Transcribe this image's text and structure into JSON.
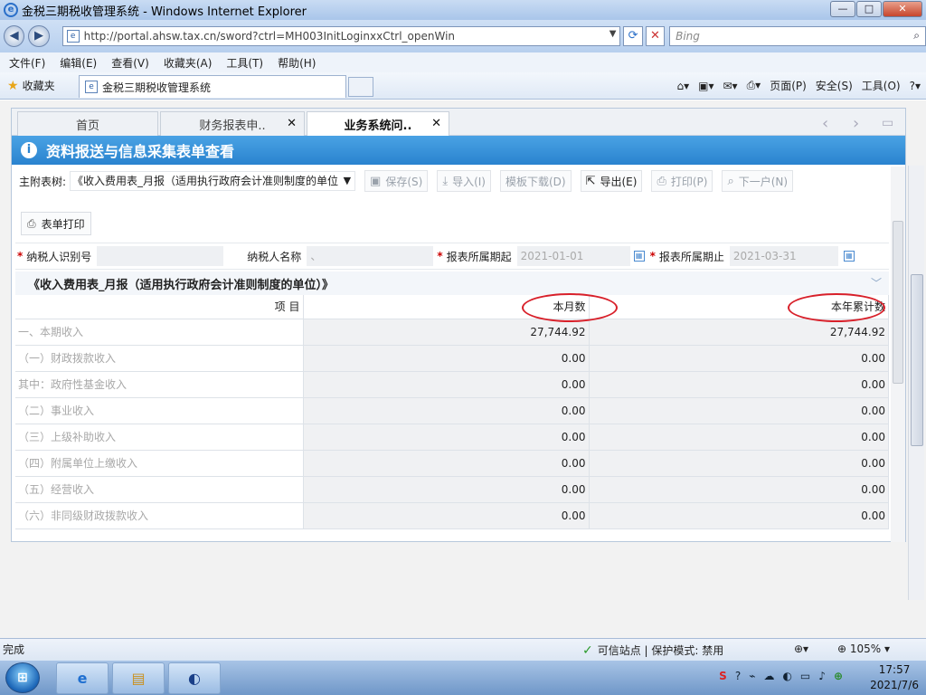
{
  "window": {
    "title": "金税三期税收管理系统 - Windows Internet Explorer",
    "controls": [
      "—",
      "□",
      "✕"
    ]
  },
  "address_bar": {
    "url": "http://portal.ahsw.tax.cn/sword?ctrl=MH003InitLoginxxCtrl_openWin",
    "search_placeholder": "Bing"
  },
  "menu": [
    "文件(F)",
    "编辑(E)",
    "查看(V)",
    "收藏夹(A)",
    "工具(T)",
    "帮助(H)"
  ],
  "favorites_bar": {
    "label": "收藏夹",
    "tab_title": "金税三期税收管理系统",
    "commands": [
      "页面(P)",
      "安全(S)",
      "工具(O)"
    ]
  },
  "app_tabs": [
    {
      "label": "首页",
      "closable": false
    },
    {
      "label": "财务报表申..",
      "closable": true
    },
    {
      "label": "业务系统问..",
      "closable": true,
      "active": true
    }
  ],
  "header": {
    "title": "资料报送与信息采集表单查看"
  },
  "toolbar": {
    "label": "主附表树:",
    "selected": "《收入费用表_月报（适用执行政府会计准则制度的单位",
    "buttons": [
      {
        "label": "保存(S)",
        "icon": "save-icon",
        "enabled": false
      },
      {
        "label": "导入(I)",
        "icon": "import-icon",
        "enabled": false
      },
      {
        "label": "模板下载(D)",
        "icon": "",
        "enabled": false
      },
      {
        "label": "导出(E)",
        "icon": "export-icon",
        "enabled": true
      },
      {
        "label": "打印(P)",
        "icon": "print-icon",
        "enabled": false
      },
      {
        "label": "下一户(N)",
        "icon": "search-icon",
        "enabled": false
      }
    ],
    "print_form": "表单打印"
  },
  "form": {
    "taxpayer_id_label": "纳税人识别号",
    "taxpayer_id": "",
    "taxpayer_name_label": "纳税人名称",
    "taxpayer_name": "、",
    "period_start_label": "报表所属期起",
    "period_start": "2021-01-01",
    "period_end_label": "报表所属期止",
    "period_end": "2021-03-31"
  },
  "section_title": "《收入费用表_月报（适用执行政府会计准则制度的单位）》",
  "table": {
    "headers": [
      "项  目",
      "本月数",
      "本年累计数"
    ],
    "rows": [
      {
        "item": "一、本期收入",
        "month": "27,744.92",
        "ytd": "27,744.92"
      },
      {
        "item": "（一）财政拨款收入",
        "month": "0.00",
        "ytd": "0.00"
      },
      {
        "item": "其中：政府性基金收入",
        "month": "0.00",
        "ytd": "0.00"
      },
      {
        "item": "（二）事业收入",
        "month": "0.00",
        "ytd": "0.00"
      },
      {
        "item": "（三）上级补助收入",
        "month": "0.00",
        "ytd": "0.00"
      },
      {
        "item": "（四）附属单位上缴收入",
        "month": "0.00",
        "ytd": "0.00"
      },
      {
        "item": "（五）经营收入",
        "month": "0.00",
        "ytd": "0.00"
      },
      {
        "item": "（六）非同级财政拨款收入",
        "month": "0.00",
        "ytd": "0.00"
      }
    ]
  },
  "status_bar": {
    "left": "完成",
    "zone": "可信站点 | 保护模式: 禁用",
    "zoom": "105%"
  },
  "taskbar": {
    "time": "17:57",
    "date": "2021/7/6"
  },
  "colors": {
    "header_blue": "#2a83cf",
    "highlight_red": "#d8202a"
  }
}
